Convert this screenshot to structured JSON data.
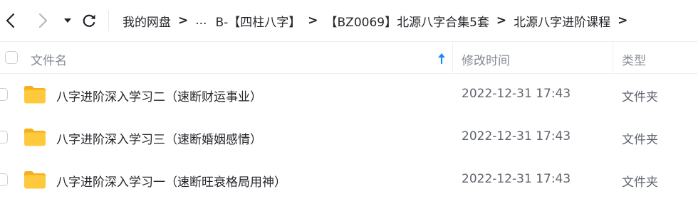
{
  "toolbar": {
    "breadcrumbs": [
      {
        "label": "我的网盘"
      },
      {
        "label": "..."
      },
      {
        "label": "B-【四柱八字】"
      },
      {
        "label": "【BZ0069】北源八字合集5套"
      },
      {
        "label": "北源八字进阶课程"
      }
    ],
    "crumb_separator": ">",
    "icons": {
      "back": "chevron-left-icon",
      "forward": "chevron-right-icon",
      "history": "caret-down-icon",
      "refresh": "refresh-icon"
    }
  },
  "table": {
    "columns": {
      "name": "文件名",
      "modified": "修改时间",
      "type": "类型"
    },
    "sort": {
      "column": "name",
      "direction": "ascending",
      "icon": "arrow-up-icon"
    },
    "rows": [
      {
        "name": "八字进阶深入学习二（速断财运事业）",
        "modified": "2022-12-31 17:43",
        "type": "文件夹",
        "icon": "folder-icon"
      },
      {
        "name": "八字进阶深入学习三（速断婚姻感情）",
        "modified": "2022-12-31 17:43",
        "type": "文件夹",
        "icon": "folder-icon"
      },
      {
        "name": "八字进阶深入学习一（速断旺衰格局用神）",
        "modified": "2022-12-31 17:43",
        "type": "文件夹",
        "icon": "folder-icon"
      }
    ]
  },
  "colors": {
    "accent": "#1a88f5",
    "folder": "#ffc93e",
    "folder_tab": "#f5b11c"
  }
}
